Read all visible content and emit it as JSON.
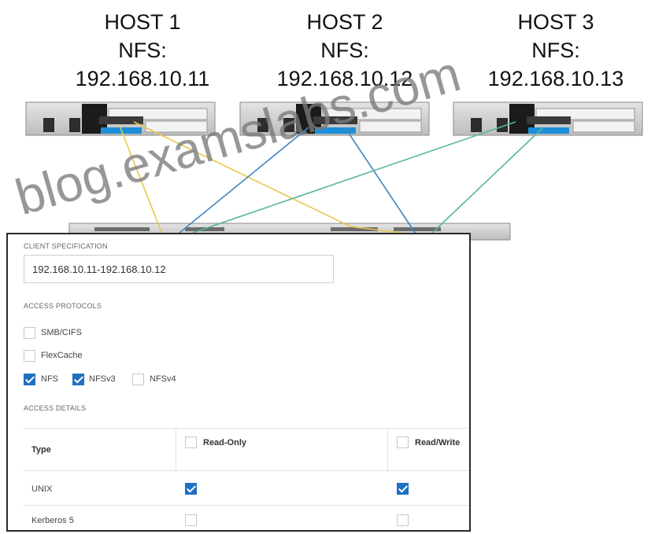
{
  "hosts": [
    {
      "title": "HOST 1",
      "protocol": "NFS:",
      "ip": "192.168.10.11"
    },
    {
      "title": "HOST 2",
      "protocol": "NFS:",
      "ip": "192.168.10.12"
    },
    {
      "title": "HOST 3",
      "protocol": "NFS:",
      "ip": "192.168.10.13"
    }
  ],
  "colors": {
    "yellow": "#e8c84a",
    "blue": "#3f86c2",
    "green": "#55b79a",
    "checkbox": "#1f70c1"
  },
  "panel": {
    "client_spec_label": "CLIENT SPECIFICATION",
    "client_spec_value": "192.168.10.11-192.168.10.12",
    "access_protocols_label": "ACCESS PROTOCOLS",
    "protocols": [
      {
        "label": "SMB/CIFS",
        "checked": false
      },
      {
        "label": "FlexCache",
        "checked": false
      },
      {
        "label": "NFS",
        "checked": true
      },
      {
        "label": "NFSv3",
        "checked": true
      },
      {
        "label": "NFSv4",
        "checked": false
      }
    ],
    "access_details_label": "ACCESS DETAILS",
    "table": {
      "headers": [
        "Type",
        "Read-Only",
        "Read/Write"
      ],
      "rows": [
        {
          "type": "UNIX",
          "read_only": true,
          "read_write": true
        },
        {
          "type": "Kerberos 5",
          "read_only": false,
          "read_write": false
        }
      ]
    }
  },
  "watermark": {
    "line1": "blog.examslabs.com",
    "piece1": "blog.",
    "piece2": "exams",
    "piece3": "labs.com"
  }
}
